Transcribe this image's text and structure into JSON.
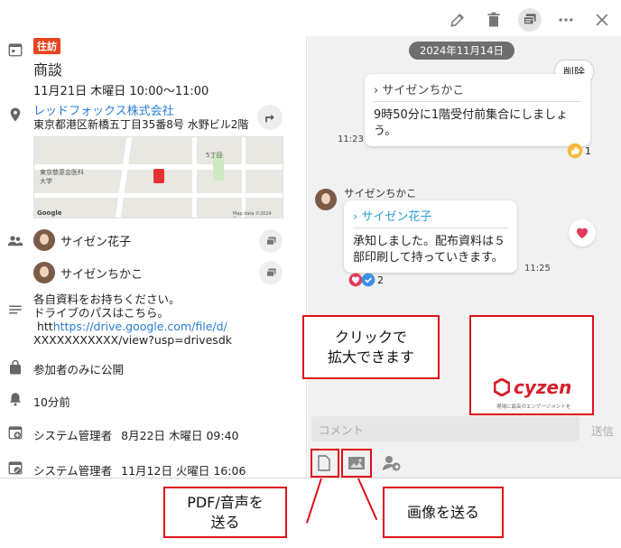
{
  "left": {
    "badge": "往訪",
    "title": "商談",
    "datetime": "11月21日 木曜日 10:00〜11:00",
    "company": "レッドフォックス株式会社",
    "address": "東京都港区新橋五丁目35番8号 水野ビル2階",
    "map": {
      "label_area": "東京慈恵会医科大学",
      "label_block": "5丁目",
      "google": "Google",
      "copyright": "Map data ©2024 Google"
    },
    "participants": [
      "サイゼン花子",
      "サイゼンちかこ"
    ],
    "note_line1": "各自資料をお持ちください。",
    "note_line2": "ドライブのパスはこちら。",
    "note_line3_prefix": "htt",
    "note_line3_link": "https://drive.google.com/file/d/",
    "note_line4": "XXXXXXXXXXX/view?usp=drivesdk",
    "visibility": "参加者のみに公開",
    "reminder": "10分前",
    "created_by": "システム管理者",
    "created_at": "8月22日 木曜日 09:40",
    "updated_by": "システム管理者",
    "updated_at": "11月12日 火曜日 16:06"
  },
  "right": {
    "date_pill": "2024年11月14日",
    "delete_label": "削除",
    "msg1": {
      "quote": "サイゼンちかこ",
      "text_line1": "9時50分に1階受付前集合にしましょ",
      "text_line2": "う。",
      "time": "11:23",
      "reaction_count": "1"
    },
    "msg2": {
      "sender": "サイゼンちかこ",
      "quote": "サイゼン花子",
      "text_line1": "承知しました。配布資料は５",
      "text_line2": "部印刷して持っていきます。",
      "time": "11:25",
      "reaction_count": "2"
    },
    "comment_placeholder": "コメント",
    "send_label": "送信"
  },
  "annotations": {
    "click_line1": "クリックで",
    "click_line2": "拡大できます",
    "pdf_line1": "PDF/音声を",
    "pdf_line2": "送る",
    "image_label": "画像を送る",
    "cyzen_logo": "cyzen",
    "cyzen_sub": "現場に最高のエンゲージメントを"
  },
  "icons": [
    "edit-icon",
    "trash-icon",
    "chat-icon",
    "more-icon",
    "close-icon",
    "calendar-icon",
    "location-icon",
    "route-icon",
    "people-icon",
    "notes-icon",
    "lock-icon",
    "bell-icon",
    "add-calendar-icon",
    "edit-calendar-icon",
    "file-icon",
    "image-icon",
    "send-person-icon",
    "heart-icon",
    "check-icon",
    "thumbs-up-icon"
  ],
  "colors": {
    "badge": "#e8451e",
    "link": "#2a7dd4",
    "quote_link": "#2a9fd0",
    "heart": "#e23b5a",
    "annotation": "#e0101a",
    "cyzen": "#d5202a"
  }
}
